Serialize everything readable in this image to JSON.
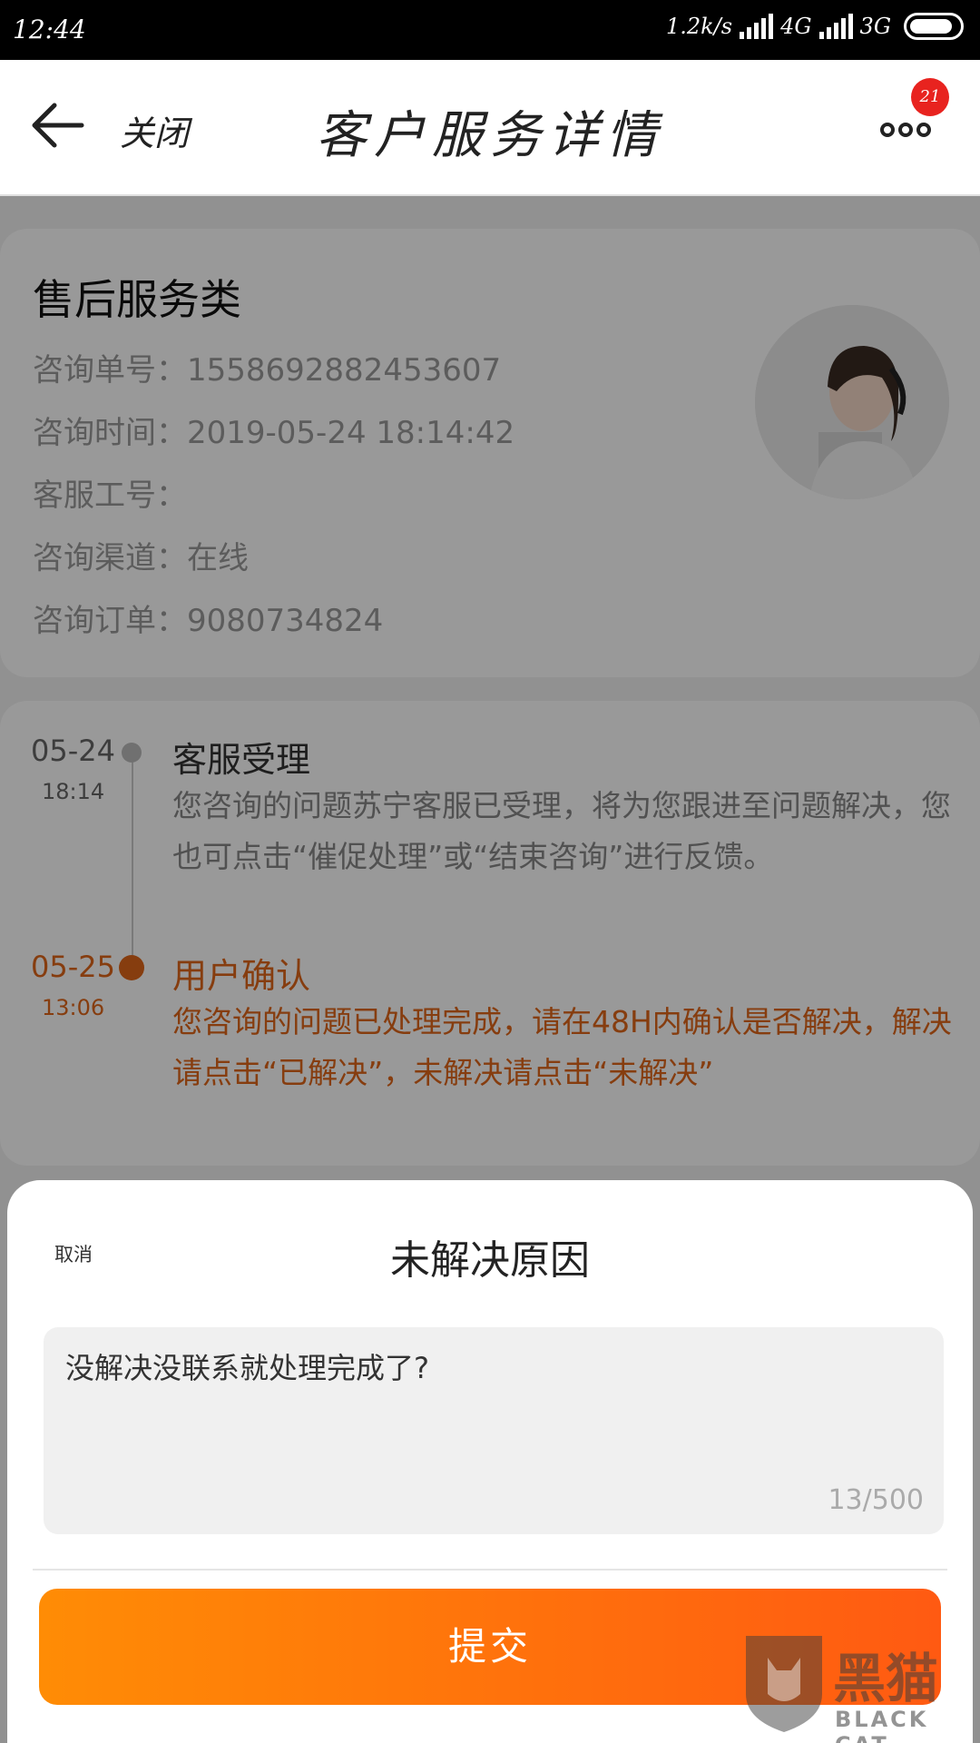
{
  "status_bar": {
    "time": "12:44",
    "network_speed": "1.2k/s",
    "net_type_1": "4G",
    "net_type_2": "3G"
  },
  "nav": {
    "close_label": "关闭",
    "title": "客户服务详情",
    "badge": "21"
  },
  "info": {
    "category": "售后服务类",
    "rows": [
      {
        "label": "咨询单号：",
        "value": "1558692882453607"
      },
      {
        "label": "咨询时间：",
        "value": "2019-05-24 18:14:42"
      },
      {
        "label": "客服工号：",
        "value": ""
      },
      {
        "label": "咨询渠道：",
        "value": "在线"
      },
      {
        "label": "咨询订单：",
        "value": "9080734824"
      }
    ]
  },
  "timeline": [
    {
      "date": "05-24",
      "time": "18:14",
      "title": "客服受理",
      "desc": "您咨询的问题苏宁客服已受理，将为您跟进至问题解决，您也可点击“催促处理”或“结束咨询”进行反馈。"
    },
    {
      "date": "05-25",
      "time": "13:06",
      "title": "用户确认",
      "desc": "您咨询的问题已处理完成，请在48H内确认是否解决，解决请点击“已解决”，未解决请点击“未解决”"
    }
  ],
  "sheet": {
    "cancel_label": "取消",
    "title": "未解决原因",
    "reason_text": "没解决没联系就处理完成了?",
    "char_count": "13/500",
    "submit_label": "提交"
  },
  "watermark": {
    "text": "黑猫",
    "sub": "BLACK CAT"
  },
  "colors": {
    "accent": "#e0661a",
    "button_start": "#ff8c05",
    "button_end": "#ff5a12",
    "badge": "#e8231f"
  }
}
